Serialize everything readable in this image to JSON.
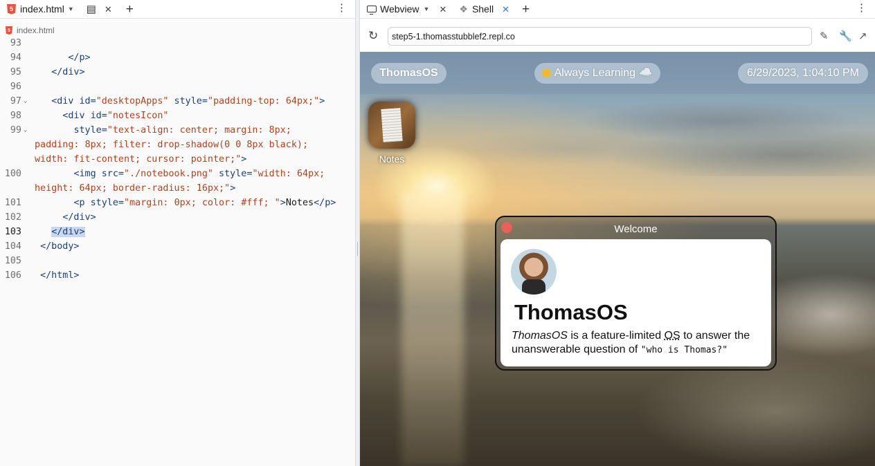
{
  "editor": {
    "tab_name": "index.html",
    "file_badge": "5",
    "breadcrumb": "index.html",
    "lines": [
      {
        "num": "93",
        "parts": []
      },
      {
        "num": "94",
        "indent": "      ",
        "parts": [
          [
            "tg",
            "</p>"
          ]
        ]
      },
      {
        "num": "95",
        "indent": "   ",
        "parts": [
          [
            "tg",
            "</div>"
          ]
        ]
      },
      {
        "num": "96",
        "parts": []
      },
      {
        "num": "97",
        "fold": true,
        "indent": "   ",
        "parts": [
          [
            "tg",
            "<div "
          ],
          [
            "at",
            "id="
          ],
          [
            "st",
            "\"desktopApps\""
          ],
          [
            "at",
            " style="
          ],
          [
            "st",
            "\"padding-top: "
          ],
          [
            "nu",
            "64"
          ],
          [
            "st",
            "px;\""
          ],
          [
            "tg",
            ">"
          ]
        ]
      },
      {
        "num": "98",
        "indent": "     ",
        "parts": [
          [
            "tg",
            "<div "
          ],
          [
            "at",
            "id="
          ],
          [
            "st",
            "\"notesIcon\""
          ]
        ]
      },
      {
        "num": "99",
        "fold": true,
        "indent": "       ",
        "parts": [
          [
            "at",
            "style="
          ],
          [
            "st",
            "\"text-align: center; margin: "
          ],
          [
            "nu",
            "8"
          ],
          [
            "st",
            "px;"
          ]
        ]
      },
      {
        "num": "",
        "parts": [
          [
            "st",
            "padding: "
          ],
          [
            "nu",
            "8"
          ],
          [
            "st",
            "px; filter: drop-shadow("
          ],
          [
            "nu",
            "0 0 8"
          ],
          [
            "st",
            "px black);"
          ]
        ]
      },
      {
        "num": "",
        "parts": [
          [
            "st",
            "width: fit-content; cursor: pointer;\""
          ],
          [
            "tg",
            ">"
          ]
        ]
      },
      {
        "num": "100",
        "indent": "       ",
        "parts": [
          [
            "tg",
            "<img "
          ],
          [
            "at",
            "src="
          ],
          [
            "st",
            "\"./notebook.png\""
          ],
          [
            "at",
            " style="
          ],
          [
            "st",
            "\"width: "
          ],
          [
            "nu",
            "64"
          ],
          [
            "st",
            "px;"
          ]
        ]
      },
      {
        "num": "",
        "parts": [
          [
            "st",
            "height: "
          ],
          [
            "nu",
            "64"
          ],
          [
            "st",
            "px; border-radius: "
          ],
          [
            "nu",
            "16"
          ],
          [
            "st",
            "px;\""
          ],
          [
            "tg",
            ">"
          ]
        ]
      },
      {
        "num": "101",
        "indent": "       ",
        "parts": [
          [
            "tg",
            "<p "
          ],
          [
            "at",
            "style="
          ],
          [
            "st",
            "\"margin: "
          ],
          [
            "nu",
            "0"
          ],
          [
            "st",
            "px; color: #fff; \""
          ],
          [
            "tg",
            ">"
          ],
          [
            "pl",
            "Notes"
          ],
          [
            "tg",
            "</p>"
          ]
        ]
      },
      {
        "num": "102",
        "indent": "     ",
        "parts": [
          [
            "tg",
            "</div>"
          ]
        ]
      },
      {
        "num": "103",
        "current": true,
        "indent": "   ",
        "parts": [
          [
            "sel",
            "</div>"
          ]
        ]
      },
      {
        "num": "104",
        "indent": " ",
        "parts": [
          [
            "tg",
            "</body>"
          ]
        ]
      },
      {
        "num": "105",
        "parts": []
      },
      {
        "num": "106",
        "indent": " ",
        "parts": [
          [
            "tg",
            "</html>"
          ]
        ]
      }
    ]
  },
  "webview": {
    "tab_webview": "Webview",
    "tab_shell": "Shell",
    "url": "step5-1.thomasstubblef2.repl.co"
  },
  "os": {
    "brand": "ThomasOS",
    "center_text": "Always Learning ☁️",
    "clock": "6/29/2023, 1:04:10 PM",
    "notes_label": "Notes",
    "window": {
      "title": "Welcome",
      "heading": "ThomasOS",
      "desc_italic": "ThomasOS",
      "desc_part1": " is a feature-limited ",
      "desc_abbr": "OS",
      "desc_part2": " to answer the unanswerable question of ",
      "desc_code": "\"who is Thomas?\""
    }
  },
  "colors": {
    "html_badge": "#e5533d",
    "close_button": "#e8615a",
    "selection": "#c8d7ee"
  }
}
